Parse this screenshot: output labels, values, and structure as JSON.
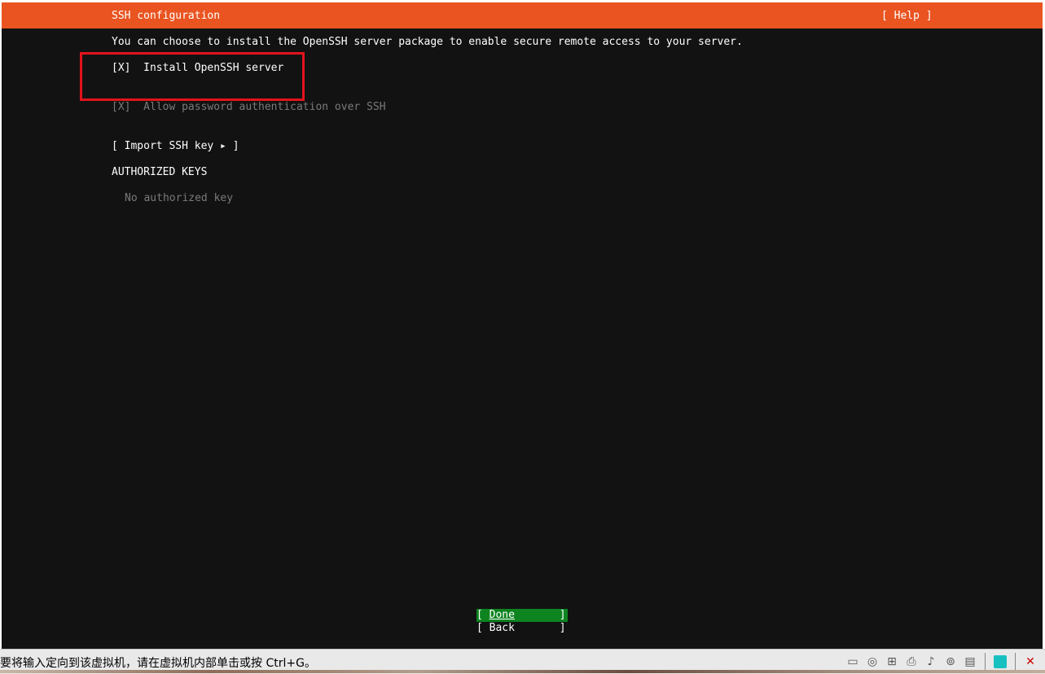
{
  "header": {
    "title": "SSH configuration",
    "help": "[ Help ]"
  },
  "description": "You can choose to install the OpenSSH server package to enable secure remote access to your server.",
  "options": {
    "install_openssh": "[X]  Install OpenSSH server",
    "allow_password": "[X]  Allow password authentication over SSH"
  },
  "import_ssh_key": "[ Import SSH key ▸ ]",
  "authorized_keys": {
    "heading": "AUTHORIZED KEYS",
    "empty": "No authorized key"
  },
  "buttons": {
    "done_open": "[ ",
    "done_label": "Done",
    "done_close": "       ]",
    "back": "[ Back       ]"
  },
  "statusbar": {
    "message": "要将输入定向到该虚拟机，请在虚拟机内部单击或按 Ctrl+G。",
    "icons": [
      "hard-disk-icon",
      "cd-rom-icon",
      "network-icon",
      "printer-icon",
      "sound-icon",
      "usb-icon",
      "floppy-icon",
      "note-icon",
      "device-disconnected-icon"
    ]
  },
  "colors": {
    "header": "#e95420",
    "done_button": "#0e8420",
    "background": "#121212",
    "annotation": "#e3131b"
  }
}
